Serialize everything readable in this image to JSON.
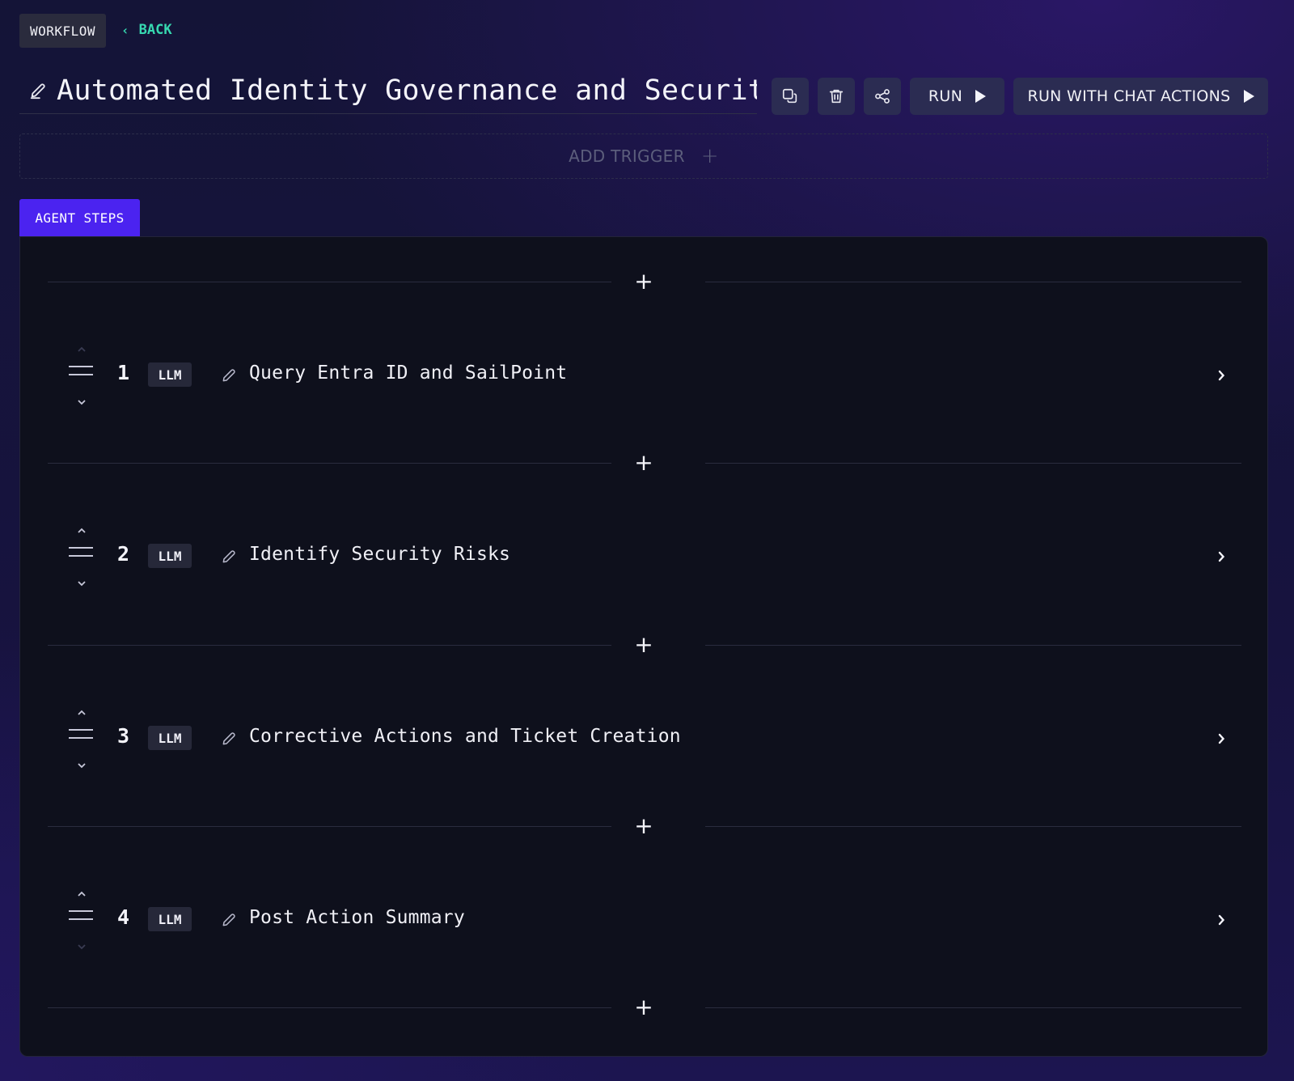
{
  "header": {
    "section_badge": "WORKFLOW",
    "back_label": "BACK",
    "title": "Automated Identity Governance and Security",
    "run_label": "RUN",
    "run_chat_label": "RUN WITH CHAT ACTIONS",
    "icons": [
      "edit-icon",
      "copy-icon",
      "trash-icon",
      "share-icon",
      "play-icon"
    ]
  },
  "trigger": {
    "label": "ADD TRIGGER"
  },
  "tabs": [
    {
      "label": "AGENT STEPS",
      "active": true
    }
  ],
  "steps": [
    {
      "number": "1",
      "type": "LLM",
      "name": "Query Entra ID and SailPoint"
    },
    {
      "number": "2",
      "type": "LLM",
      "name": "Identify Security Risks"
    },
    {
      "number": "3",
      "type": "LLM",
      "name": "Corrective Actions and Ticket Creation"
    },
    {
      "number": "4",
      "type": "LLM",
      "name": "Post Action Summary"
    }
  ],
  "colors": {
    "accent_tab": "#4b23f0",
    "back_link": "#37d8b0",
    "button_bg": "#2b2c52",
    "panel_bg": "#0e101c"
  }
}
